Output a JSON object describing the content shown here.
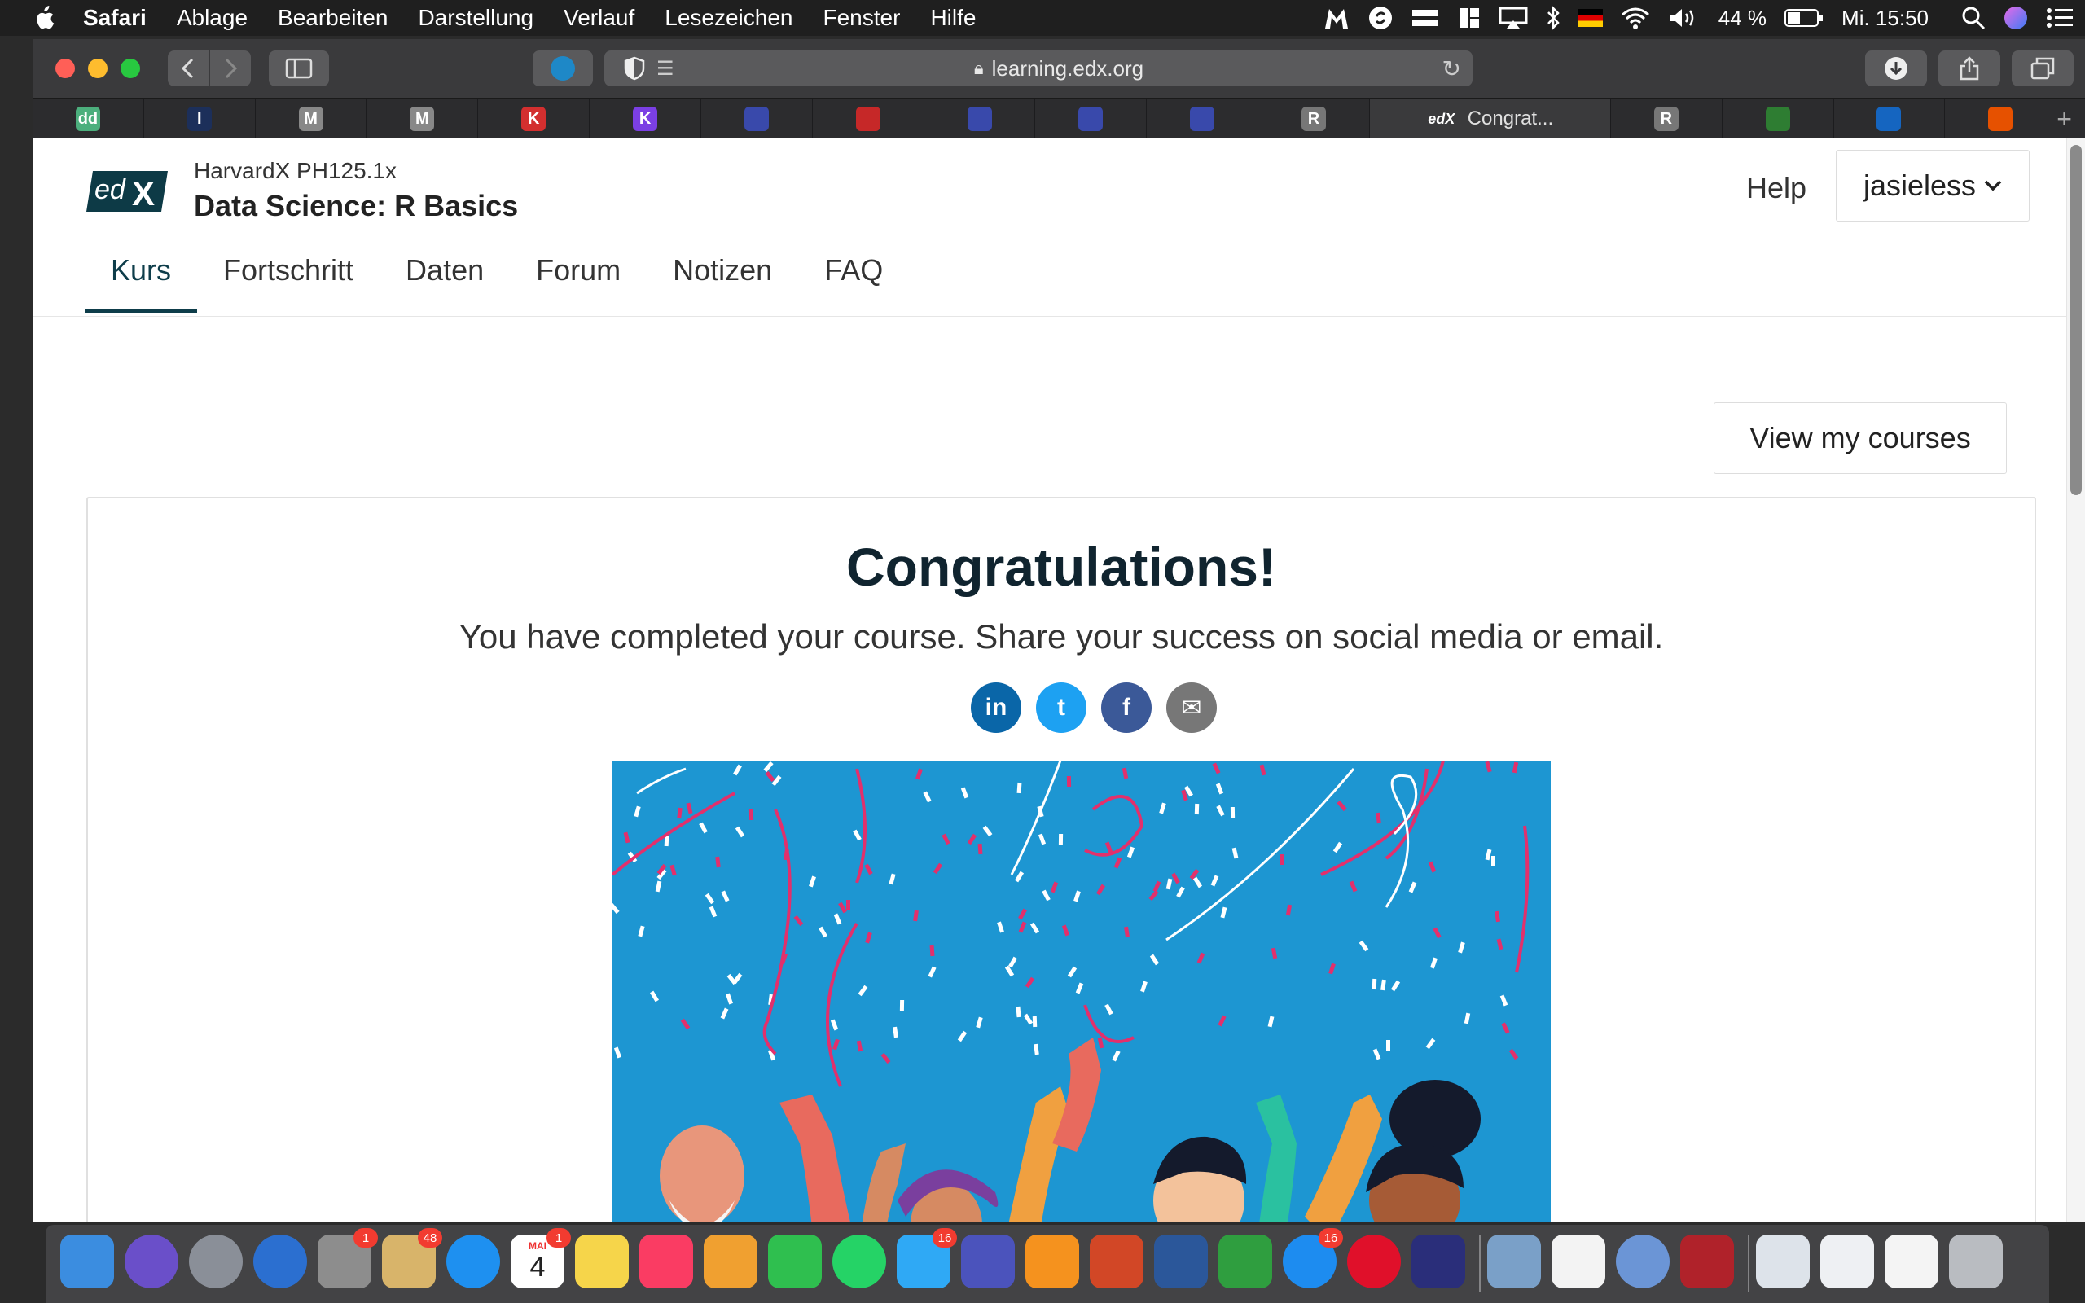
{
  "menubar": {
    "app_name": "Safari",
    "items": [
      "Ablage",
      "Bearbeiten",
      "Darstellung",
      "Verlauf",
      "Lesezeichen",
      "Fenster",
      "Hilfe"
    ],
    "battery": "44 %",
    "clock": "Mi. 15:50"
  },
  "browser": {
    "url": "learning.edx.org",
    "tabs": [
      {
        "icon": "dd",
        "color": "#4caf7d"
      },
      {
        "icon": "I",
        "color": "#1c2f5a"
      },
      {
        "icon": "M",
        "color": "#888888"
      },
      {
        "icon": "M",
        "color": "#888888"
      },
      {
        "icon": "K",
        "color": "#d32f2f"
      },
      {
        "icon": "K",
        "color": "#7b3fe4"
      },
      {
        "icon": "",
        "color": "#3949ab"
      },
      {
        "icon": "",
        "color": "#c62828"
      },
      {
        "icon": "",
        "color": "#3949ab"
      },
      {
        "icon": "",
        "color": "#3949ab"
      },
      {
        "icon": "",
        "color": "#3949ab"
      },
      {
        "icon": "R",
        "color": "#777777"
      },
      {
        "icon": "edX",
        "color": "#3a3a3c",
        "title": "Congrat...",
        "active": true
      },
      {
        "icon": "R",
        "color": "#777777"
      },
      {
        "icon": "",
        "color": "#2e7d32"
      },
      {
        "icon": "",
        "color": "#1565c0"
      },
      {
        "icon": "",
        "color": "#e65100"
      }
    ]
  },
  "page": {
    "course_org": "HarvardX PH125.1x",
    "course_title": "Data Science: R Basics",
    "help": "Help",
    "username": "jasieless",
    "nav_tabs": [
      "Kurs",
      "Fortschritt",
      "Daten",
      "Forum",
      "Notizen",
      "FAQ"
    ],
    "view_courses": "View my courses",
    "congrats_title": "Congratulations!",
    "congrats_subtitle": "You have completed your course. Share your success on social media or email.",
    "share": [
      {
        "label": "in",
        "color": "#0a66a8"
      },
      {
        "label": "t",
        "color": "#1da1f2"
      },
      {
        "label": "f",
        "color": "#3b5998"
      },
      {
        "label": "✉",
        "color": "#777777"
      }
    ],
    "image_bg": "#1d96d2"
  },
  "dock": {
    "badges": {
      "system_prefs": "1",
      "mail": "48",
      "calendar": "1",
      "messages": "16",
      "app_store": "16"
    },
    "calendar_month": "MAI",
    "calendar_day": "4"
  }
}
